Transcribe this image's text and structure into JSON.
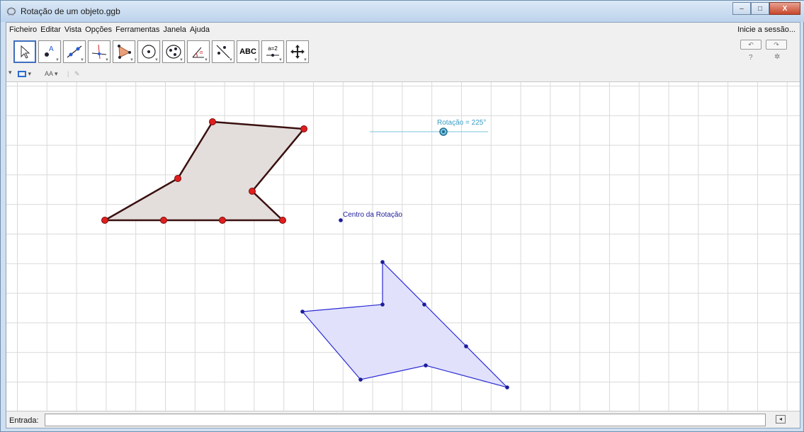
{
  "window": {
    "title": "Rotação de um objeto.ggb",
    "min": "–",
    "max": "□",
    "close": "X"
  },
  "menu": {
    "items": [
      "Ficheiro",
      "Editar",
      "Vista",
      "Opções",
      "Ferramentas",
      "Janela",
      "Ajuda"
    ],
    "login": "Inicie a sessão..."
  },
  "toolbar": {
    "tools": [
      {
        "name": "move-tool",
        "icon": "arrow-pointer-icon"
      },
      {
        "name": "point-tool",
        "icon": "point-icon"
      },
      {
        "name": "line-tool",
        "icon": "line-icon"
      },
      {
        "name": "perpendicular-tool",
        "icon": "perpendicular-icon"
      },
      {
        "name": "polygon-tool",
        "icon": "polygon-icon"
      },
      {
        "name": "circle-tool",
        "icon": "circle-icon"
      },
      {
        "name": "conic-tool",
        "icon": "ellipse-icon"
      },
      {
        "name": "angle-tool",
        "icon": "angle-icon"
      },
      {
        "name": "reflect-tool",
        "icon": "reflect-icon"
      },
      {
        "name": "text-tool",
        "icon": "text-icon",
        "label": "ABC"
      },
      {
        "name": "slider-tool",
        "icon": "slider-icon",
        "label": "a=2"
      },
      {
        "name": "move-view-tool",
        "icon": "move-view-icon"
      }
    ],
    "help": "?"
  },
  "graphics": {
    "slider_label": "Rotação = 225°",
    "center_label": "Centro da Rotação",
    "colors": {
      "original_fill": "#e3dedb",
      "original_stroke": "#3a1010",
      "original_point": "#e11e1e",
      "rotated_fill": "#e1e1fb",
      "rotated_stroke": "#2a2ad6",
      "rotated_point": "#1c1c9a",
      "slider": "#3aa0c8"
    }
  },
  "input": {
    "label": "Entrada:",
    "value": ""
  }
}
